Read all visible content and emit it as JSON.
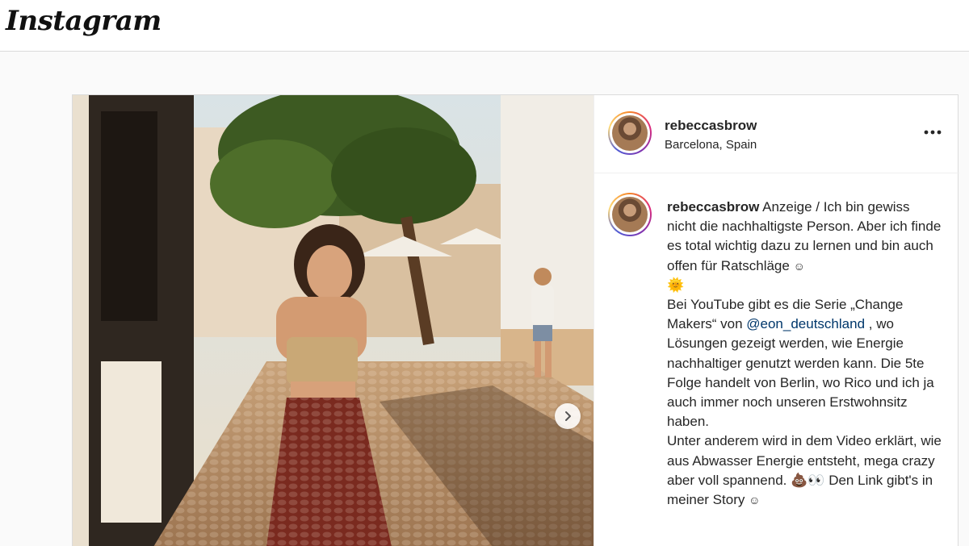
{
  "app": {
    "logo_text": "Instagram"
  },
  "post": {
    "username": "rebeccasbrow",
    "location": "Barcelona, Spain",
    "caption": {
      "username": "rebeccasbrow",
      "line1": "Anzeige / Ich bin gewiss nicht die nachhaltigste Person. Aber ich finde es total wichtig dazu zu lernen und bin auch offen für Ratschläge",
      "emoji1": "☺",
      "emoji2": "🌞",
      "line2_before": "Bei YouTube gibt es die Serie „Change Makers“ von",
      "mention": "@eon_deutschland",
      "line2_after": ", wo Lösungen gezeigt werden, wie Energie nachhaltiger genutzt werden kann. Die 5te Folge handelt von Berlin, wo Rico und ich ja auch immer noch unseren Erstwohnsitz haben.",
      "line3": "Unter anderem wird in dem Video erklärt, wie aus Abwasser Energie entsteht, mega crazy aber voll spannend.",
      "emoji3": "💩👀",
      "line3_after": "Den Link gibt's in meiner Story",
      "emoji4": "☺"
    },
    "icons": {
      "more": "more-options-icon",
      "next": "chevron-right-icon"
    }
  }
}
